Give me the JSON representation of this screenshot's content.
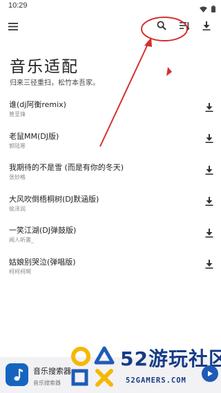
{
  "status_bar": {
    "time": "10:29"
  },
  "header": {
    "title": "音乐适配",
    "subtitle": "归来三径重扫，松竹本吾家。"
  },
  "songs": [
    {
      "title": "谁(dj阿衡remix)",
      "artist": "曾至锋"
    },
    {
      "title": "老鼠MM(DJ版)",
      "artist": "郭陆寒"
    },
    {
      "title": "我期待的不是雪 (而是有你的冬天)",
      "artist": "张妙格"
    },
    {
      "title": "大风吹倒梧桐树(DJ默涵版)",
      "artist": "侯泽润"
    },
    {
      "title": "一笑江湖(DJ弹鼓版)",
      "artist": "闻人听書_"
    },
    {
      "title": "姑娘别哭泣(弹唱版)",
      "artist": "柯柯柯啊"
    }
  ],
  "bottom_bar": {
    "app_name": "音乐搜索器",
    "app_sub": "音乐搜索器"
  },
  "watermark": {
    "brand": "52游玩社区",
    "domain": "52GAMERS.COM"
  },
  "colors": {
    "accent": "#1565c0",
    "annotation": "#d32f2f",
    "watermark": "#163c86"
  },
  "icons": [
    "menu-icon",
    "search-icon",
    "sort-icon",
    "download-icon"
  ]
}
